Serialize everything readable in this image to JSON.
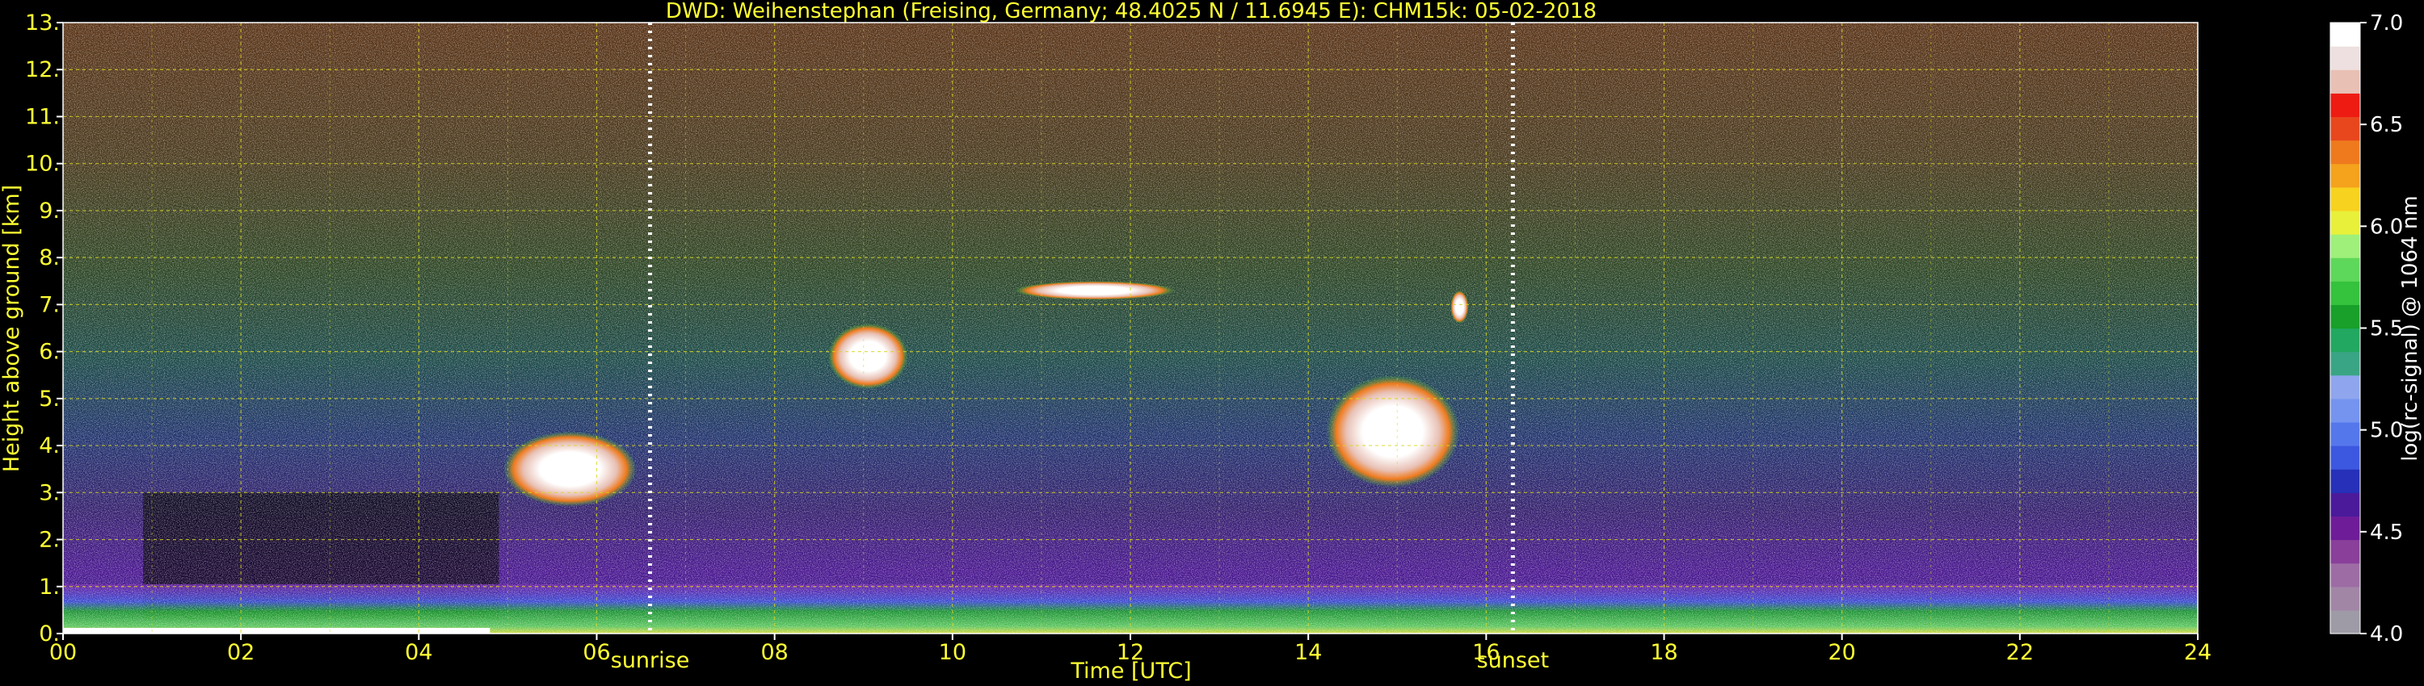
{
  "chart_data": {
    "type": "heatmap",
    "title": "DWD: Weihenstephan (Freising, Germany; 48.4025 N / 11.6945 E):    CHM15k: 05-02-2018",
    "xlabel": "Time [UTC]",
    "ylabel": "Height above ground [km]",
    "xlim": [
      0,
      24
    ],
    "ylim": [
      0,
      13
    ],
    "x_ticks": [
      {
        "value": 0,
        "label": "00"
      },
      {
        "value": 2,
        "label": "02"
      },
      {
        "value": 4,
        "label": "04"
      },
      {
        "value": 6,
        "label": "06"
      },
      {
        "value": 8,
        "label": "08"
      },
      {
        "value": 10,
        "label": "10"
      },
      {
        "value": 12,
        "label": "12"
      },
      {
        "value": 14,
        "label": "14"
      },
      {
        "value": 16,
        "label": "16"
      },
      {
        "value": 18,
        "label": "18"
      },
      {
        "value": 20,
        "label": "20"
      },
      {
        "value": 22,
        "label": "22"
      },
      {
        "value": 24,
        "label": "24"
      }
    ],
    "y_ticks": [
      {
        "value": 0,
        "label": "0."
      },
      {
        "value": 1,
        "label": "1."
      },
      {
        "value": 2,
        "label": "2."
      },
      {
        "value": 3,
        "label": "3."
      },
      {
        "value": 4,
        "label": "4."
      },
      {
        "value": 5,
        "label": "5."
      },
      {
        "value": 6,
        "label": "6."
      },
      {
        "value": 7,
        "label": "7."
      },
      {
        "value": 8,
        "label": "8."
      },
      {
        "value": 9,
        "label": "9."
      },
      {
        "value": 10,
        "label": "10."
      },
      {
        "value": 11,
        "label": "11."
      },
      {
        "value": 12,
        "label": "12."
      },
      {
        "value": 13,
        "label": "13."
      }
    ],
    "grid": true,
    "markers": [
      {
        "label": "sunrise",
        "time": 6.6
      },
      {
        "label": "sunset",
        "time": 16.3
      }
    ],
    "colorbar": {
      "label": "log(rc-signal) @ 1064 nm",
      "range": [
        4.0,
        7.0
      ],
      "ticks": [
        "4.0",
        "4.5",
        "5.0",
        "5.5",
        "6.0",
        "6.5",
        "7.0"
      ],
      "colors": [
        "#9e9aa6",
        "#a286a6",
        "#9d6ca4",
        "#8a3f9b",
        "#6e1c98",
        "#4a1a9b",
        "#2630b8",
        "#3c58e0",
        "#5577ec",
        "#7594f0",
        "#8fa6ee",
        "#3aa585",
        "#22a860",
        "#18a02a",
        "#35c23c",
        "#5ed85a",
        "#9ef07a",
        "#e8f03a",
        "#f7d21e",
        "#f5a21c",
        "#ef7a1e",
        "#e8471e",
        "#ee1b12",
        "#e8c0b4",
        "#eee0e0",
        "#ffffff"
      ]
    },
    "features": [
      {
        "name": "cloud",
        "t_start": 4.95,
        "t_end": 6.45,
        "h_bottom": 2.7,
        "h_top": 4.3
      },
      {
        "name": "cloud",
        "t_start": 8.6,
        "t_end": 9.5,
        "h_bottom": 5.2,
        "h_top": 6.6
      },
      {
        "name": "cloud",
        "t_start": 10.7,
        "t_end": 12.5,
        "h_bottom": 7.1,
        "h_top": 7.5
      },
      {
        "name": "cloud",
        "t_start": 14.2,
        "t_end": 15.7,
        "h_bottom": 3.1,
        "h_top": 5.5
      },
      {
        "name": "cloud",
        "t_start": 15.6,
        "t_end": 15.8,
        "h_bottom": 6.6,
        "h_top": 7.3
      }
    ]
  }
}
